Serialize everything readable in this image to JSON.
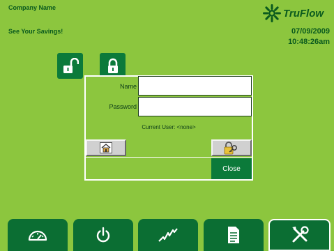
{
  "header": {
    "company": "Company Name",
    "tagline": "See Your Savings!",
    "brand": "TruFlow",
    "date": "07/09/2009",
    "time": "10:48:26am"
  },
  "login": {
    "name_label": "Name",
    "password_label": "Password",
    "name_value": "",
    "password_value": "",
    "current_user": "Current User: <none>",
    "close_label": "Close"
  },
  "icons": {
    "unlock": "unlocked-padlock-icon",
    "lock": "locked-padlock-icon",
    "home": "home-icon",
    "key": "key-padlock-icon"
  },
  "nav": {
    "tabs": [
      "gauge-icon",
      "power-icon",
      "trend-chart-icon",
      "document-icon",
      "tools-icon"
    ],
    "active": "tools-icon"
  },
  "colors": {
    "background": "#8cc63e",
    "dark_green": "#0b7a3a",
    "text": "#0a5a1e"
  }
}
